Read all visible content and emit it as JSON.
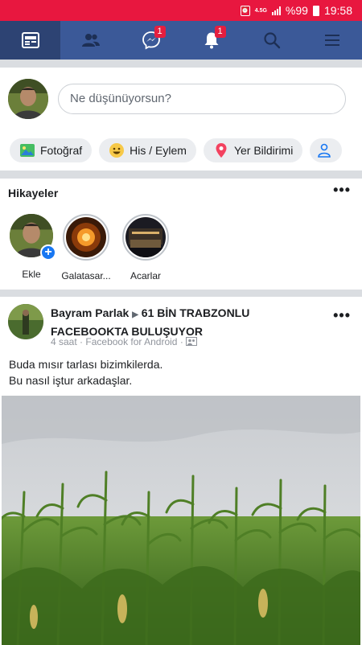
{
  "status_bar": {
    "network": "4.5G",
    "battery": "%99",
    "time": "19:58"
  },
  "nav": {
    "tabs": [
      {
        "icon": "news-feed-icon",
        "active": true
      },
      {
        "icon": "friends-icon"
      },
      {
        "icon": "messenger-icon",
        "badge": "1"
      },
      {
        "icon": "notifications-icon",
        "badge": "1"
      },
      {
        "icon": "search-icon"
      },
      {
        "icon": "menu-icon"
      }
    ]
  },
  "composer": {
    "placeholder": "Ne düşünüyorsun?",
    "chips": [
      {
        "label": "Fotoğraf",
        "icon": "photo-icon"
      },
      {
        "label": "His / Eylem",
        "icon": "smiley-icon"
      },
      {
        "label": "Yer Bildirimi",
        "icon": "location-pin-icon"
      }
    ]
  },
  "stories": {
    "title": "Hikayeler",
    "items": [
      {
        "label": "Ekle"
      },
      {
        "label": "Galatasar..."
      },
      {
        "label": "Acarlar"
      }
    ]
  },
  "post": {
    "author": "Bayram Parlak",
    "target": "61 BİN TRABZONLU FACEBOOKTA BULUŞUYOR",
    "time": "4 saat",
    "source": "Facebook for Android",
    "text_line1": "Buda mısır tarlası bizimkilerda.",
    "text_line2": "Bu nasıl iştur arkadaşlar."
  },
  "colors": {
    "status_bar": "#e8173f",
    "navbar": "#3b5998",
    "navbar_active": "#2d4373",
    "badge": "#e41e3f",
    "divider": "#dadde1"
  }
}
